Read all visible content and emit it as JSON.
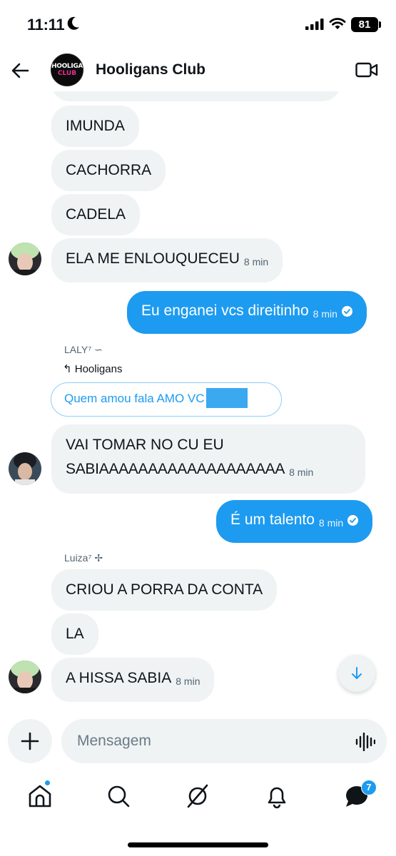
{
  "status_bar": {
    "time": "11:11",
    "battery": "81"
  },
  "header": {
    "title": "Hooligans Club",
    "avatar_line1": "HOOLIGAN",
    "avatar_line2": "CLUB"
  },
  "messages": [
    {
      "text": "IMUNDA"
    },
    {
      "text": "CACHORRA"
    },
    {
      "text": "CADELA"
    },
    {
      "text": "ELA ME ENLOUQUECEU",
      "time": "8 min"
    },
    {
      "text": "Eu enganei vcs direitinho",
      "time": "8 min"
    },
    {
      "text_line1": "VAI TOMAR NO CU EU",
      "text_line2": "SABIAAAAAAAAAAAAAAAAAAA",
      "time": "8 min"
    },
    {
      "text": "É um talento",
      "time": "8 min"
    },
    {
      "text": "CRIOU A PORRA DA CONTA"
    },
    {
      "text": "LA"
    },
    {
      "text": "A HISSA SABIA",
      "time": "8 min"
    }
  ],
  "senders": {
    "laly": "LALY⁷ ∽",
    "luiza": "Luiza⁷ ✢"
  },
  "reply": {
    "context": "Hooligans",
    "quote": "Quem amou fala AMO VC"
  },
  "composer": {
    "placeholder": "Mensagem"
  },
  "tabbar": {
    "messages_badge": "7"
  },
  "colors": {
    "accent": "#1d9bf0",
    "incoming_bubble": "#eff3f4"
  }
}
